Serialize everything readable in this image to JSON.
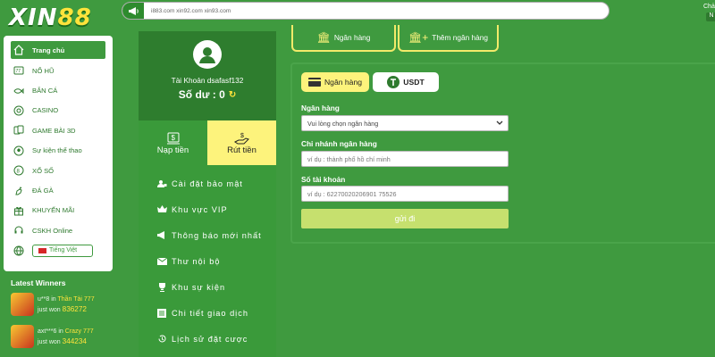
{
  "brand": {
    "logo_main": "XIN",
    "logo_num": "88"
  },
  "announce": {
    "domains": "i883.com  xin92.com  xin93.com"
  },
  "topright": {
    "cut_text": "Chả",
    "cut_btn": "N"
  },
  "sidebar": {
    "items": [
      {
        "label": "Trang chủ",
        "icon": "home-icon"
      },
      {
        "label": "NỔ HŨ",
        "icon": "slot-icon"
      },
      {
        "label": "BẮN CÁ",
        "icon": "fish-icon"
      },
      {
        "label": "CASINO",
        "icon": "casino-icon"
      },
      {
        "label": "GAME BÀI 3D",
        "icon": "cards-icon"
      },
      {
        "label": "Sự kiện thể thao",
        "icon": "ball-icon"
      },
      {
        "label": "XỔ SỐ",
        "icon": "lottery-icon"
      },
      {
        "label": "ĐÁ GÀ",
        "icon": "rooster-icon"
      },
      {
        "label": "KHUYẾN MÃI",
        "icon": "gift-icon"
      },
      {
        "label": "CSKH Online",
        "icon": "support-icon"
      }
    ],
    "language": "Tiếng Việt"
  },
  "winners": {
    "title": "Latest Winners",
    "list": [
      {
        "user": "u**8",
        "game": "Thần Tài 777",
        "won_label": "just won",
        "amount": "836272"
      },
      {
        "user": "axt***6",
        "game": "Crazy 777",
        "won_label": "just won",
        "amount": "344234"
      }
    ],
    "in_word": "in"
  },
  "account": {
    "name": "Tài Khoản dsafasf132",
    "balance_label": "Số dư : 0",
    "deposit": "Nạp tiền",
    "withdraw": "Rút tiền",
    "menu": [
      {
        "label": "Cài đặt bảo mật",
        "icon": "user-lock-icon"
      },
      {
        "label": "Khu vực VIP",
        "icon": "crown-icon"
      },
      {
        "label": "Thông báo mới nhất",
        "icon": "megaphone-icon"
      },
      {
        "label": "Thư nội bộ",
        "icon": "mail-icon"
      },
      {
        "label": "Khu sự kiện",
        "icon": "trophy-icon"
      },
      {
        "label": "Chi tiết giao dịch",
        "icon": "list-icon"
      },
      {
        "label": "Lịch sử đặt cược",
        "icon": "history-icon"
      }
    ]
  },
  "bank": {
    "top_buttons": [
      "Ngân hàng",
      "Thêm ngân hàng"
    ],
    "tabs": [
      "Ngân hàng",
      "USDT"
    ],
    "fields": {
      "bank_label": "Ngân hàng",
      "bank_select": "Vui lòng chọn ngân hàng",
      "branch_label": "Chi nhánh ngân hàng",
      "branch_placeholder": "ví dụ : thành phố hồ chí minh",
      "account_label": "Số tài khoản",
      "account_placeholder": "ví dụ : 62270020206901 75526"
    },
    "submit": "gửi đi"
  }
}
